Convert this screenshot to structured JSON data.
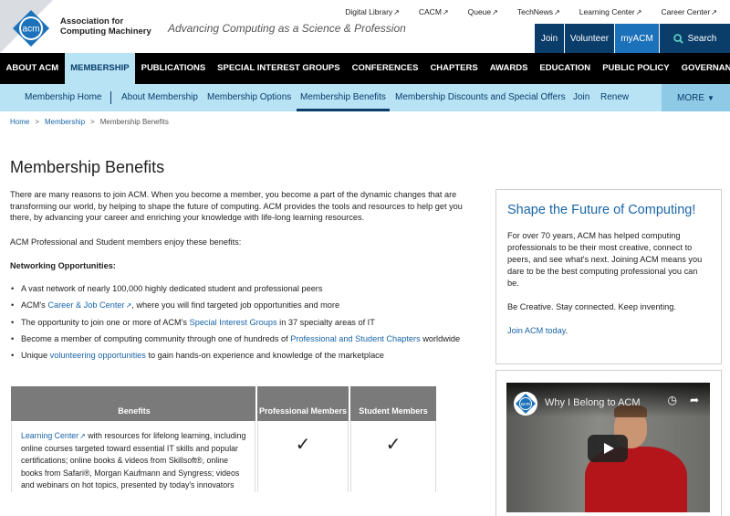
{
  "header": {
    "logo_abbr": "acm",
    "org_name_line1": "Association for",
    "org_name_line2": "Computing Machinery",
    "tagline": "Advancing Computing as a Science & Profession",
    "top_links": [
      "Digital Library",
      "CACM",
      "Queue",
      "TechNews",
      "Learning Center",
      "Career Center"
    ],
    "external_icon": "external-link-icon",
    "actions": {
      "join": "Join",
      "volunteer": "Volunteer",
      "myacm": "myACM",
      "search": "Search"
    }
  },
  "main_nav": [
    "ABOUT ACM",
    "MEMBERSHIP",
    "PUBLICATIONS",
    "SPECIAL INTEREST GROUPS",
    "CONFERENCES",
    "CHAPTERS",
    "AWARDS",
    "EDUCATION",
    "PUBLIC POLICY",
    "GOVERNANCE"
  ],
  "sub_nav": {
    "items": [
      "Membership Home",
      "About Membership",
      "Membership Options",
      "Membership Benefits",
      "Membership Discounts and Special Offers",
      "Join",
      "Renew"
    ],
    "more": "MORE"
  },
  "breadcrumb": [
    "Home",
    "Membership",
    "Membership Benefits"
  ],
  "page_title": "Membership Benefits",
  "intro": "There are many reasons to join ACM. When you become a member, you become a part of the dynamic changes that are transforming our world, by helping to shape the future of computing. ACM provides the tools and resources to help get you there, by advancing your career and enriching your knowledge with life-long learning resources.",
  "enjoy": "ACM Professional and Student members enjoy these benefits:",
  "networking_heading": "Networking Opportunities:",
  "bullets": {
    "b1": "A vast network of nearly 100,000 highly dedicated student and professional peers",
    "b2_pre": "ACM's ",
    "b2_link": "Career & Job Center",
    "b2_post": ", where you will find targeted job opportunities and more",
    "b3_pre": "The opportunity to join one or more of ACM's ",
    "b3_link": "Special Interest Groups",
    "b3_post": " in 37 specialty areas of IT",
    "b4_pre": "Become a member of computing community through one of hundreds of ",
    "b4_link": "Professional and Student Chapters",
    "b4_post": " worldwide",
    "b5_pre": "Unique ",
    "b5_link": "volunteering opportunities",
    "b5_post": " to gain hands-on experience and knowledge of the marketplace"
  },
  "table": {
    "headers": [
      "Benefits",
      "Professional Members",
      "Student Members"
    ],
    "row1": {
      "link": "Learning Center",
      "text": " with resources for lifelong learning, including online courses targeted toward essential IT skills and popular certifications; online books & videos from Skillsoft®, online books from Safari®, Morgan Kaufmann and Syngress; videos and webinars on hot topics, presented by today's innovators",
      "professional": "✓",
      "student": "✓"
    }
  },
  "sidebar": {
    "title": "Shape the Future of Computing!",
    "p1": "For over 70 years, ACM has helped computing professionals to be their most creative, connect to peers, and see what's next. Joining ACM means you dare to be the best computing professional you can be.",
    "p2": "Be Creative. Stay connected. Keep inventing.",
    "link": "Join ACM today",
    "link_suffix": "."
  },
  "video": {
    "title": "Why I Belong to ACM",
    "logo_abbr": "acm",
    "icons": [
      "clock-icon",
      "share-icon",
      "play-icon"
    ]
  },
  "colors": {
    "navy": "#0b3d6b",
    "light_blue": "#b7e3f5",
    "link": "#1a65a8",
    "logo_blue": "#1b71ba"
  }
}
